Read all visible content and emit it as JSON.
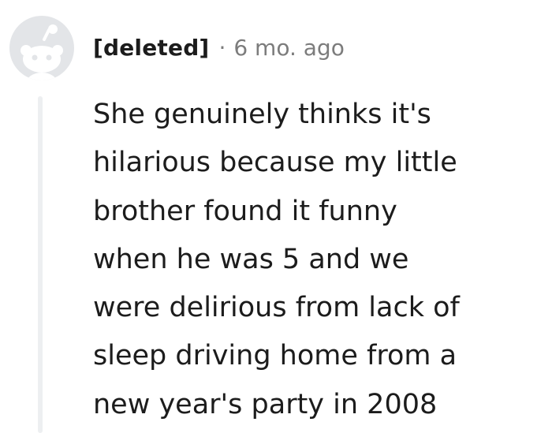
{
  "comment": {
    "author": "[deleted]",
    "separator": "·",
    "time": "6 mo. ago",
    "avatar_icon": "reddit-snoo-placeholder-icon",
    "body_lines": [
      "She genuinely thinks it's",
      "hilarious because my little",
      "brother found it funny",
      "when he was 5 and we",
      "were delirious from lack of",
      "sleep driving home from a",
      "new year's party in 2008"
    ]
  },
  "colors": {
    "text": "#1c1c1c",
    "meta_gray": "#7c7c7c",
    "avatar_bg": "#e3e5e8",
    "avatar_fg": "#ffffff",
    "thread_line": "#edeff1"
  }
}
